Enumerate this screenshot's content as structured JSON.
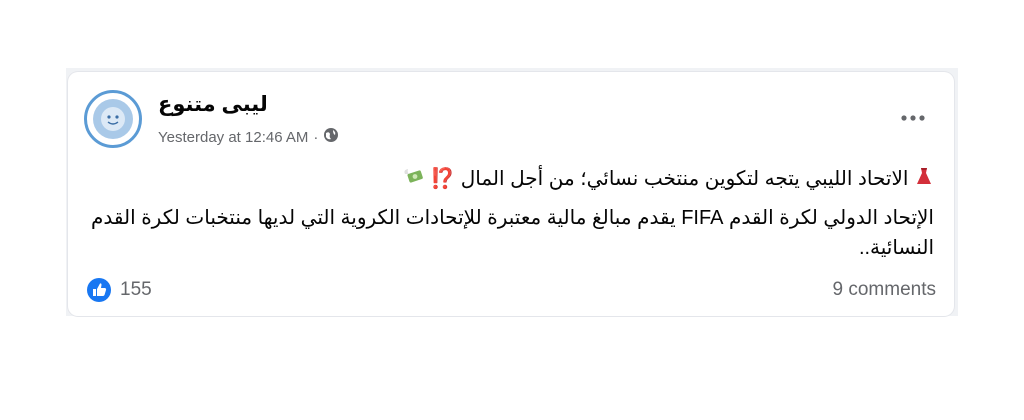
{
  "post": {
    "page_name": "ليبى متنوع",
    "timestamp": "Yesterday at 12:46 AM",
    "separator": "·",
    "privacy_icon": "globe-icon",
    "more_icon": "more-options-icon",
    "headline": "الاتحاد الليبي يتجه لتكوين منتخب نسائي؛ من أجل المال ⁉️",
    "body": "الإتحاد الدولي لكرة القدم FIFA يقدم مبالغ مالية معتبرة للإتحادات الكروية التي لديها منتخبات لكرة القدم النسائية..",
    "reaction_count": "155",
    "comments_label": "9 comments",
    "like_icon": "like-icon",
    "headline_icon": "red-dress-icon",
    "money_icon": "money-with-wings-icon"
  },
  "colors": {
    "like_blue": "#1877f2",
    "avatar_border": "#5b9bd5",
    "meta_gray": "#65676b"
  }
}
